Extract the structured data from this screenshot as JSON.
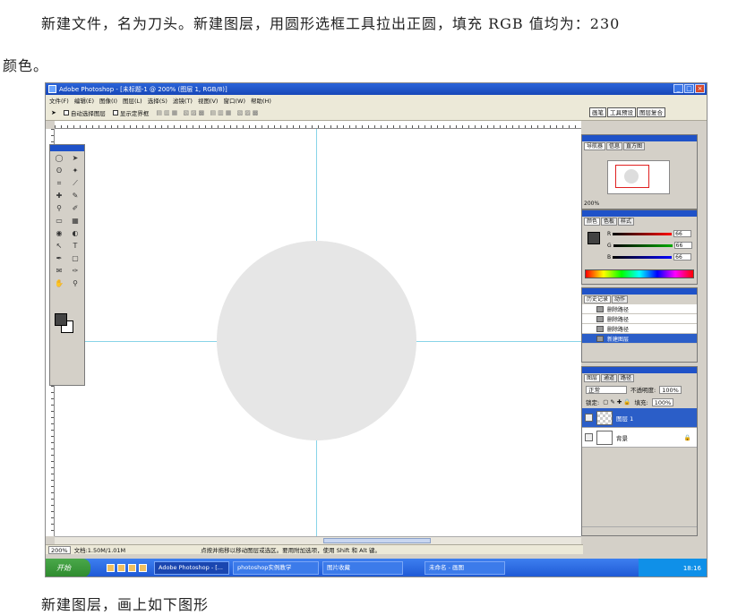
{
  "text": {
    "para1_line1": "新建文件，名为刀头。新建图层，用圆形选框工具拉出正圆，填充 RGB 值均为：230",
    "para1_line2": "颜色。",
    "para2": "新建图层，画上如下图形"
  },
  "screenshot": {
    "window_title": "Adobe Photoshop - [未标题-1 @ 200% (图层 1, RGB/8)]",
    "menu": [
      "文件(F)",
      "编辑(E)",
      "图像(I)",
      "图层(L)",
      "选择(S)",
      "滤镜(T)",
      "视图(V)",
      "窗口(W)",
      "帮助(H)"
    ],
    "options": {
      "auto_select": "自动选择图层",
      "show_bounds": "显示定界框"
    },
    "palette_tabs": [
      "画笔",
      "工具预设",
      "图层复合"
    ],
    "status": {
      "zoom": "200%",
      "doc_size": "文档:1.50M/1.01M",
      "hint": "点按并拖移以移动图层或选区。要用附加选项，使用 Shift 和 Alt 键。"
    },
    "navigator": {
      "tabs": [
        "导航器",
        "信息",
        "直方图"
      ],
      "zoom": "200%"
    },
    "color_panel": {
      "tabs": [
        "颜色",
        "色板",
        "样式"
      ],
      "channels": [
        {
          "label": "R",
          "value": "66"
        },
        {
          "label": "G",
          "value": "66"
        },
        {
          "label": "B",
          "value": "66"
        }
      ]
    },
    "history_panel": {
      "tabs": [
        "历史记录",
        "动作"
      ],
      "items": [
        "删除路径",
        "删除路径",
        "删除路径",
        "新建图层"
      ]
    },
    "layers_panel": {
      "tabs": [
        "图层",
        "通道",
        "路径"
      ],
      "blend_mode": "正常",
      "opacity_label": "不透明度:",
      "opacity": "100%",
      "lock_label": "锁定:",
      "fill_label": "填充:",
      "fill": "100%",
      "layers": [
        "图层 1",
        "背景"
      ]
    },
    "taskbar": {
      "start": "开始",
      "tasks": [
        "Adobe Photoshop - [...",
        "photoshop实例教学",
        "图片收藏",
        "未命名 - 画图"
      ],
      "clock": "18:16"
    },
    "colors": {
      "circle_fill": "#e6e6e6",
      "guide": "#88d4e8",
      "titlebar": "#1f52c8"
    }
  }
}
